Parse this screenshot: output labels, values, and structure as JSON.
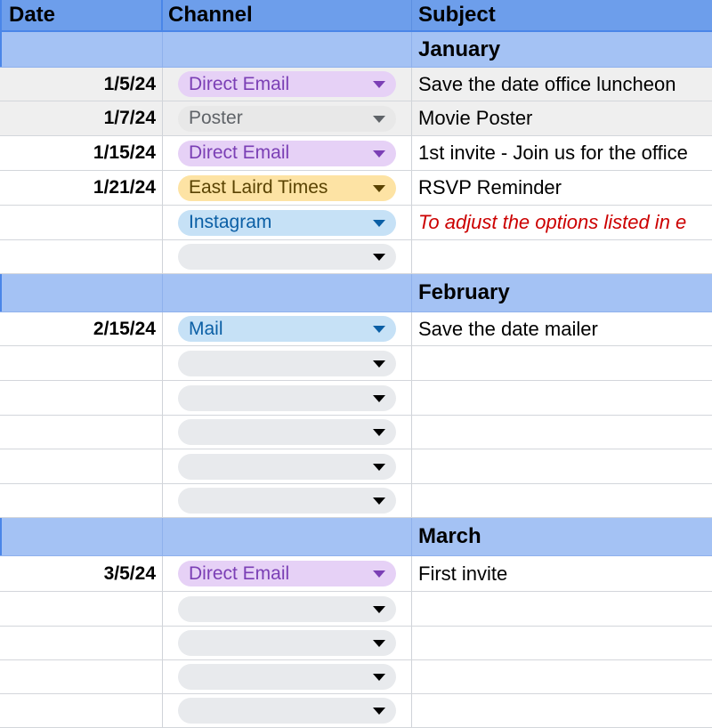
{
  "header": {
    "date": "Date",
    "channel": "Channel",
    "subject": "Subject"
  },
  "colors": {
    "header_bg": "#6d9eeb",
    "month_bg": "#a4c2f4",
    "note_text": "#cc0000"
  },
  "chip_styles": {
    "direct-email": {
      "bg": "#e6d1f6",
      "fg": "#7b3fb5",
      "caret": "#7b3fb5"
    },
    "poster": {
      "bg": "#e8e8e8",
      "fg": "#5f6368",
      "caret": "#5f6368"
    },
    "east-laird-times": {
      "bg": "#fde3a4",
      "fg": "#5a4302",
      "caret": "#5a4302"
    },
    "instagram": {
      "bg": "#c6e1f6",
      "fg": "#0b5fa5",
      "caret": "#0b5fa5"
    },
    "mail": {
      "bg": "#c6e1f6",
      "fg": "#0b5fa5",
      "caret": "#0b5fa5"
    },
    "empty": {
      "bg": "#e8eaed",
      "fg": "#5f6368",
      "caret": "#000000"
    }
  },
  "rows": [
    {
      "type": "month",
      "subject": "January"
    },
    {
      "type": "entry",
      "shaded": true,
      "date": "1/5/24",
      "channel": "Direct Email",
      "style": "direct-email",
      "subject": "Save the date office luncheon"
    },
    {
      "type": "entry",
      "shaded": true,
      "date": "1/7/24",
      "channel": "Poster",
      "style": "poster",
      "subject": "Movie Poster"
    },
    {
      "type": "entry",
      "shaded": false,
      "date": "1/15/24",
      "channel": "Direct Email",
      "style": "direct-email",
      "subject": "1st invite - Join us for the office"
    },
    {
      "type": "entry",
      "shaded": false,
      "date": "1/21/24",
      "channel": "East Laird Times",
      "style": "east-laird-times",
      "subject": "RSVP Reminder"
    },
    {
      "type": "entry",
      "shaded": false,
      "date": "",
      "channel": "Instagram",
      "style": "instagram",
      "subject": "To adjust the options listed in e",
      "note": true
    },
    {
      "type": "entry",
      "shaded": false,
      "date": "",
      "channel": "",
      "style": "empty",
      "subject": ""
    },
    {
      "type": "month",
      "subject": "February"
    },
    {
      "type": "entry",
      "shaded": false,
      "date": "2/15/24",
      "channel": "Mail",
      "style": "mail",
      "subject": "Save the date mailer"
    },
    {
      "type": "entry",
      "shaded": false,
      "date": "",
      "channel": "",
      "style": "empty",
      "subject": ""
    },
    {
      "type": "entry",
      "shaded": false,
      "date": "",
      "channel": "",
      "style": "empty",
      "subject": ""
    },
    {
      "type": "entry",
      "shaded": false,
      "date": "",
      "channel": "",
      "style": "empty",
      "subject": ""
    },
    {
      "type": "entry",
      "shaded": false,
      "date": "",
      "channel": "",
      "style": "empty",
      "subject": ""
    },
    {
      "type": "entry",
      "shaded": false,
      "date": "",
      "channel": "",
      "style": "empty",
      "subject": ""
    },
    {
      "type": "month",
      "subject": "March"
    },
    {
      "type": "entry",
      "shaded": false,
      "date": "3/5/24",
      "channel": "Direct Email",
      "style": "direct-email",
      "subject": "First invite"
    },
    {
      "type": "entry",
      "shaded": false,
      "date": "",
      "channel": "",
      "style": "empty",
      "subject": ""
    },
    {
      "type": "entry",
      "shaded": false,
      "date": "",
      "channel": "",
      "style": "empty",
      "subject": ""
    },
    {
      "type": "entry",
      "shaded": false,
      "date": "",
      "channel": "",
      "style": "empty",
      "subject": ""
    },
    {
      "type": "entry",
      "shaded": false,
      "date": "",
      "channel": "",
      "style": "empty",
      "subject": ""
    }
  ]
}
